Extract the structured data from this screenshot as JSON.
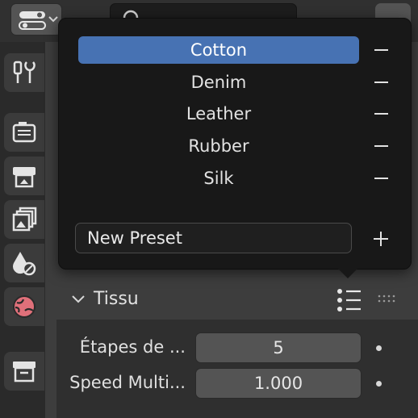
{
  "preset_menu": {
    "items": [
      {
        "label": "Cotton",
        "active": true
      },
      {
        "label": "Denim",
        "active": false
      },
      {
        "label": "Leather",
        "active": false
      },
      {
        "label": "Rubber",
        "active": false
      },
      {
        "label": "Silk",
        "active": false
      }
    ],
    "new_preset_placeholder": "New Preset"
  },
  "panel": {
    "title": "Tissu",
    "properties": [
      {
        "label": "Étapes de ...",
        "value": "5"
      },
      {
        "label": "Speed Multi...",
        "value": "1.000"
      }
    ]
  },
  "colors": {
    "accent": "#4772b3",
    "menu_bg": "#181818",
    "panel_bg": "#2f2f2f"
  },
  "icons": [
    "editor-type-icon",
    "search-icon",
    "tool-icon",
    "render-icon",
    "output-icon",
    "view-layer-icon",
    "scene-icon",
    "world-icon",
    "collection-icon",
    "preset-list-icon",
    "drag-grip-icon"
  ]
}
